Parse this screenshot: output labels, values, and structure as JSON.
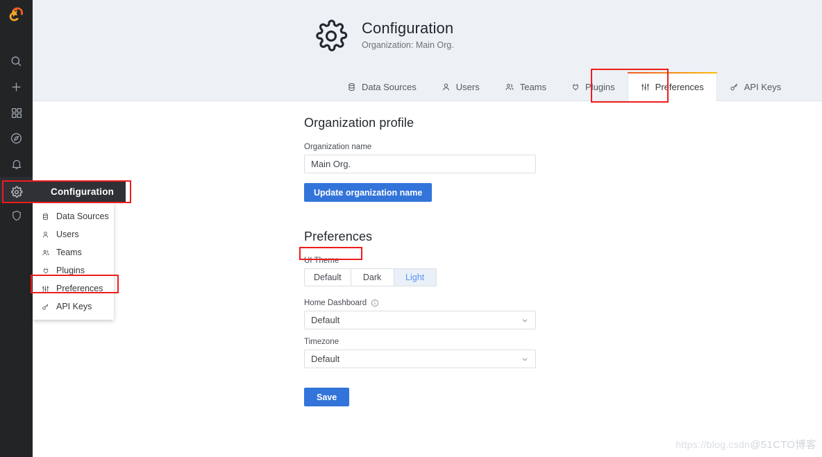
{
  "sidebar": {
    "logo": "grafana-logo",
    "items": [
      {
        "name": "search",
        "icon": "search-icon"
      },
      {
        "name": "create",
        "icon": "plus-icon"
      },
      {
        "name": "dashboards",
        "icon": "apps-grid-icon"
      },
      {
        "name": "explore",
        "icon": "compass-icon"
      },
      {
        "name": "alerting",
        "icon": "bell-icon"
      },
      {
        "name": "configuration",
        "icon": "gear-icon",
        "active": true
      },
      {
        "name": "server-admin",
        "icon": "shield-icon"
      }
    ]
  },
  "flyout": {
    "header_label": "Configuration",
    "header_icon": "gear-icon",
    "items": [
      {
        "label": "Data Sources",
        "icon": "database-icon"
      },
      {
        "label": "Users",
        "icon": "user-icon"
      },
      {
        "label": "Teams",
        "icon": "users-icon"
      },
      {
        "label": "Plugins",
        "icon": "plug-icon"
      },
      {
        "label": "Preferences",
        "icon": "sliders-icon",
        "highlighted": true
      },
      {
        "label": "API Keys",
        "icon": "key-icon"
      }
    ]
  },
  "header": {
    "icon": "gear-icon",
    "title": "Configuration",
    "subtitle": "Organization: Main Org."
  },
  "tabs": [
    {
      "label": "Data Sources",
      "icon": "database-icon",
      "active": false
    },
    {
      "label": "Users",
      "icon": "user-icon",
      "active": false
    },
    {
      "label": "Teams",
      "icon": "users-icon",
      "active": false
    },
    {
      "label": "Plugins",
      "icon": "plug-icon",
      "active": false
    },
    {
      "label": "Preferences",
      "icon": "sliders-icon",
      "active": true
    },
    {
      "label": "API Keys",
      "icon": "key-icon",
      "active": false
    }
  ],
  "org_profile": {
    "section_title": "Organization profile",
    "name_label": "Organization name",
    "name_value": "Main Org.",
    "name_placeholder": "Organization name",
    "update_button": "Update organization name"
  },
  "preferences": {
    "section_title": "Preferences",
    "ui_theme": {
      "label": "UI Theme",
      "options": [
        "Default",
        "Dark",
        "Light"
      ],
      "selected": "Light"
    },
    "home_dashboard": {
      "label": "Home Dashboard",
      "info_icon": "info-circle-icon",
      "value": "Default"
    },
    "timezone": {
      "label": "Timezone",
      "value": "Default"
    },
    "save_button": "Save"
  },
  "watermark": {
    "left": "https://blog.csdn",
    "right": "@51CTO博客"
  },
  "colors": {
    "accent_blue": "#3274d9",
    "selected_text": "#5794f2",
    "annotation_red": "#ee1c1c",
    "tab_gradient_start": "#f05a28",
    "tab_gradient_end": "#fbbc05",
    "nav_bg": "#222426",
    "header_bg": "#edf0f4"
  }
}
